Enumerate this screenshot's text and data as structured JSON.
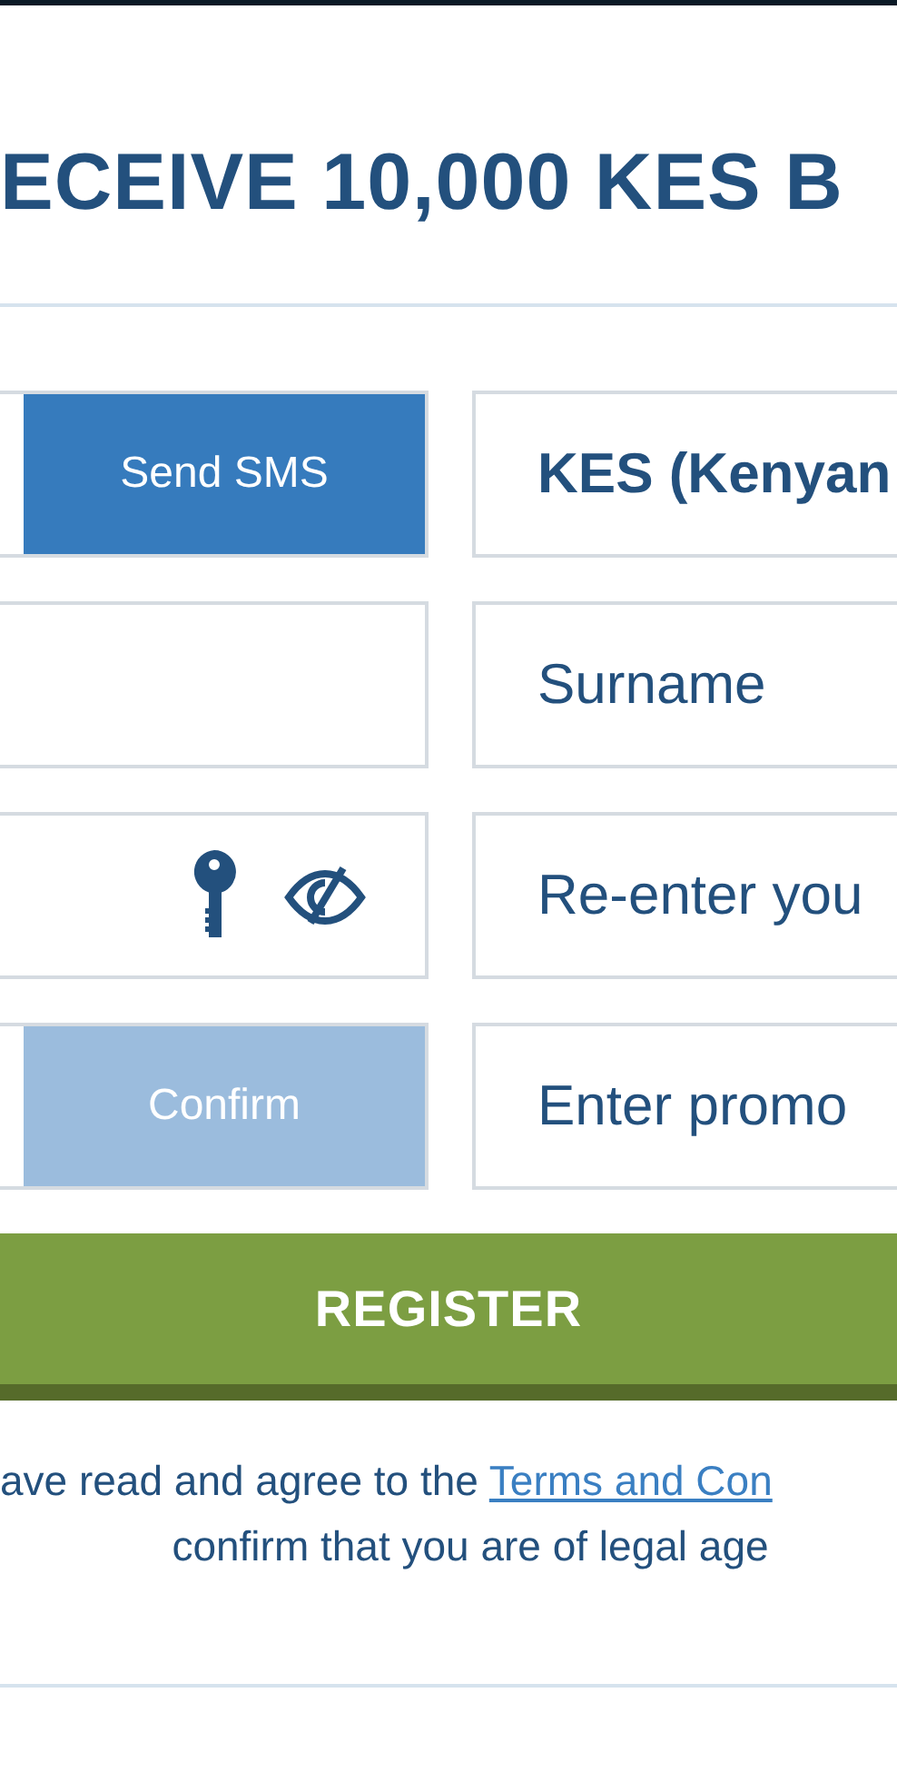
{
  "heading": "ECEIVE 10,000 KES B",
  "rows": [
    {
      "left": {
        "kind": "button",
        "button": {
          "label": "Send SMS",
          "disabled": false
        }
      },
      "right": {
        "kind": "select",
        "value": "KES (Kenyan"
      }
    },
    {
      "left": {
        "kind": "blank"
      },
      "right": {
        "kind": "input",
        "placeholder": "Surname"
      }
    },
    {
      "left": {
        "kind": "password"
      },
      "right": {
        "kind": "input",
        "placeholder": "Re-enter you"
      }
    },
    {
      "left": {
        "kind": "button",
        "button": {
          "label": "Confirm",
          "disabled": true
        }
      },
      "right": {
        "kind": "input",
        "placeholder": "Enter promo"
      }
    }
  ],
  "register_button": "REGISTER",
  "terms": {
    "before": "ave read and agree to the ",
    "link": "Terms and Con",
    "after": "confirm that you are of legal age"
  }
}
